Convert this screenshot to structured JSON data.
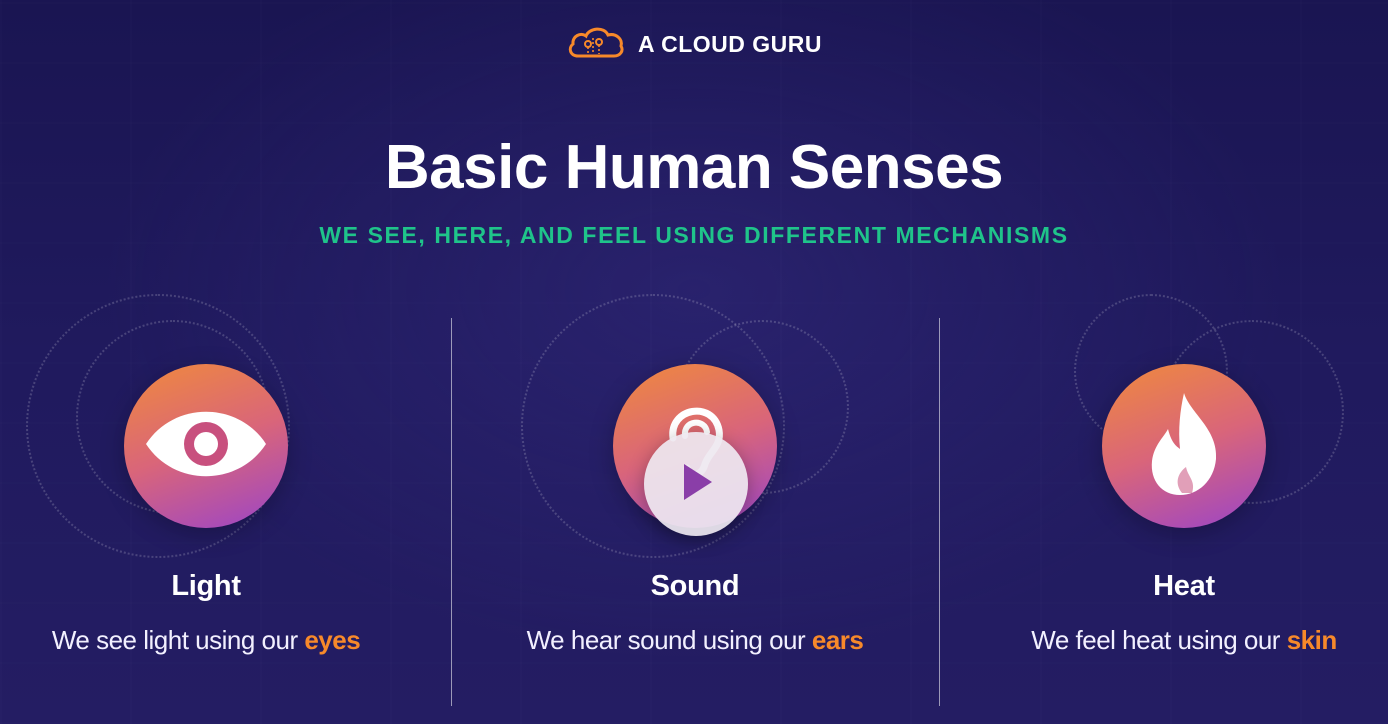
{
  "brand": {
    "name": "A CLOUD GURU",
    "logo_icon": "cloud-icon",
    "color": "#f7892a"
  },
  "heading": {
    "title": "Basic Human Senses",
    "subtitle": "WE SEE, HERE, AND FEEL USING DIFFERENT MECHANISMS"
  },
  "senses": [
    {
      "label": "Light",
      "desc_prefix": "We see light using our ",
      "organ": "eyes",
      "icon": "eye-icon"
    },
    {
      "label": "Sound",
      "desc_prefix": "We hear sound using our ",
      "organ": "ears",
      "icon": "ear-icon"
    },
    {
      "label": "Heat",
      "desc_prefix": "We feel heat using our ",
      "organ": "skin",
      "icon": "flame-icon"
    }
  ],
  "player": {
    "icon": "play-icon"
  },
  "colors": {
    "accent_orange": "#f7892a",
    "subtitle_green": "#1fc48a",
    "background": "#1f1a5c"
  }
}
